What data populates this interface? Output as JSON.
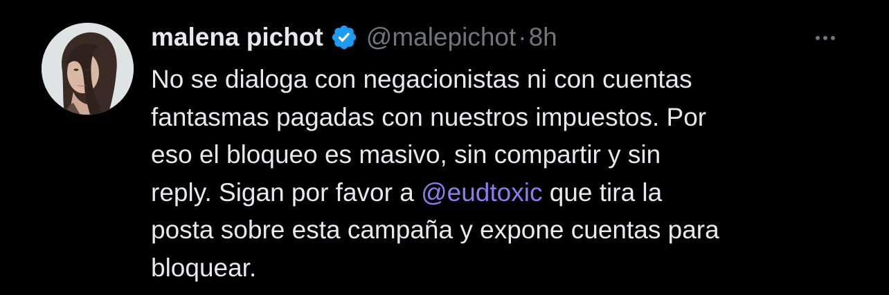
{
  "tweet": {
    "author": {
      "display_name": "malena pichot",
      "handle": "@malepichot",
      "verified": true
    },
    "separator": "·",
    "timestamp": "8h",
    "more_icon": "more-horizontal-icon",
    "text_lines": {
      "l1": "No se dialoga con negacionistas ni con cuentas",
      "l2": "fantasmas pagadas con nuestros impuestos. Por",
      "l3": "eso el bloqueo es masivo, sin compartir y sin",
      "l4_before": "reply. Sigan por favor a ",
      "l4_mention": "@eudtoxic",
      "l4_after": " que tira la",
      "l5": "posta sobre esta campaña y expone cuentas para",
      "l6": "bloquear."
    }
  },
  "colors": {
    "background": "#000000",
    "primary_text": "#e7e9ea",
    "secondary_text": "#71767b",
    "mention": "#8a7df0",
    "verified_badge": "#1d9bf0"
  }
}
